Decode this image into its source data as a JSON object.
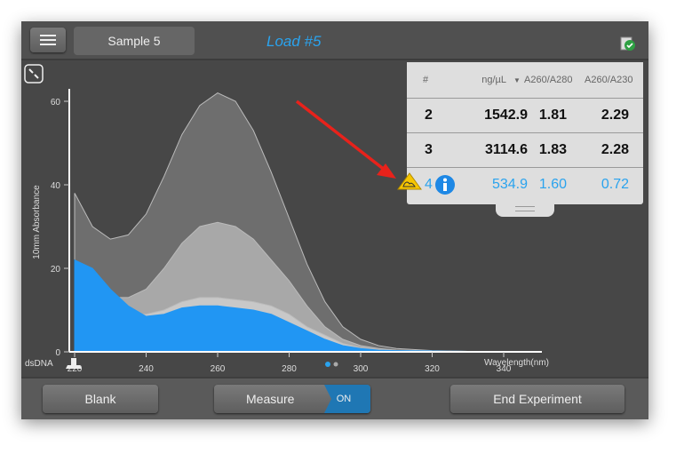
{
  "header": {
    "sample_label": "Sample 5",
    "load_label": "Load #5"
  },
  "table": {
    "columns": [
      "#",
      "ng/µL",
      "A260/A280",
      "A260/A230"
    ],
    "rows": [
      {
        "id": "2",
        "conc": "1542.9",
        "a280": "1.81",
        "a230": "2.29"
      },
      {
        "id": "3",
        "conc": "3114.6",
        "a280": "1.83",
        "a230": "2.28"
      },
      {
        "id": "4",
        "conc": "534.9",
        "a280": "1.60",
        "a230": "0.72",
        "selected": true,
        "warning": true
      }
    ]
  },
  "footer": {
    "blank": "Blank",
    "measure": "Measure",
    "measure_state": "ON",
    "end": "End Experiment"
  },
  "chart_meta": {
    "sample_type": "dsDNA",
    "page_indicator": {
      "pages": 2,
      "current": 1
    }
  },
  "colors": {
    "accent": "#2aa3ee",
    "selected_series": "#2196f3"
  },
  "chart_data": {
    "type": "area",
    "xlabel": "Wavelength(nm)",
    "ylabel": "10mm Absorbance",
    "xlim": [
      218,
      352
    ],
    "ylim": [
      0,
      62
    ],
    "xticks": [
      220,
      240,
      260,
      280,
      300,
      320,
      340
    ],
    "yticks": [
      0,
      20,
      40,
      60
    ],
    "x": [
      220,
      225,
      230,
      235,
      240,
      245,
      250,
      255,
      260,
      265,
      270,
      275,
      280,
      285,
      290,
      295,
      300,
      305,
      310,
      320,
      330,
      340,
      350
    ],
    "series": [
      {
        "id": "3",
        "color": "#6e6e6e",
        "values": [
          38,
          30,
          27,
          28,
          33,
          42,
          52,
          59,
          62,
          60,
          53,
          43,
          32,
          21,
          12,
          6,
          3,
          1.5,
          0.8,
          0.3,
          0.1,
          0,
          0
        ]
      },
      {
        "id": "2",
        "color": "#a8a8a8",
        "values": [
          22,
          16,
          13,
          13,
          15,
          20,
          26,
          30,
          31,
          30,
          27,
          22,
          17,
          11,
          6,
          3,
          1.5,
          0.8,
          0.4,
          0.2,
          0.1,
          0,
          0
        ]
      },
      {
        "id": "4b",
        "color": "#c8c8c8",
        "values": [
          12,
          10,
          9,
          9,
          9,
          10,
          12,
          13,
          13,
          12.5,
          12,
          11,
          9,
          6,
          4,
          2,
          1,
          0.5,
          0.3,
          0.1,
          0,
          0,
          0
        ]
      },
      {
        "id": "4",
        "color": "#2196f3",
        "values": [
          22,
          20,
          15,
          11,
          8.5,
          9,
          10.5,
          11,
          11,
          10.5,
          10,
          9,
          7,
          5,
          3,
          1.5,
          0.8,
          0.4,
          0.3,
          0.2,
          0.1,
          0.1,
          0.1
        ]
      }
    ]
  }
}
